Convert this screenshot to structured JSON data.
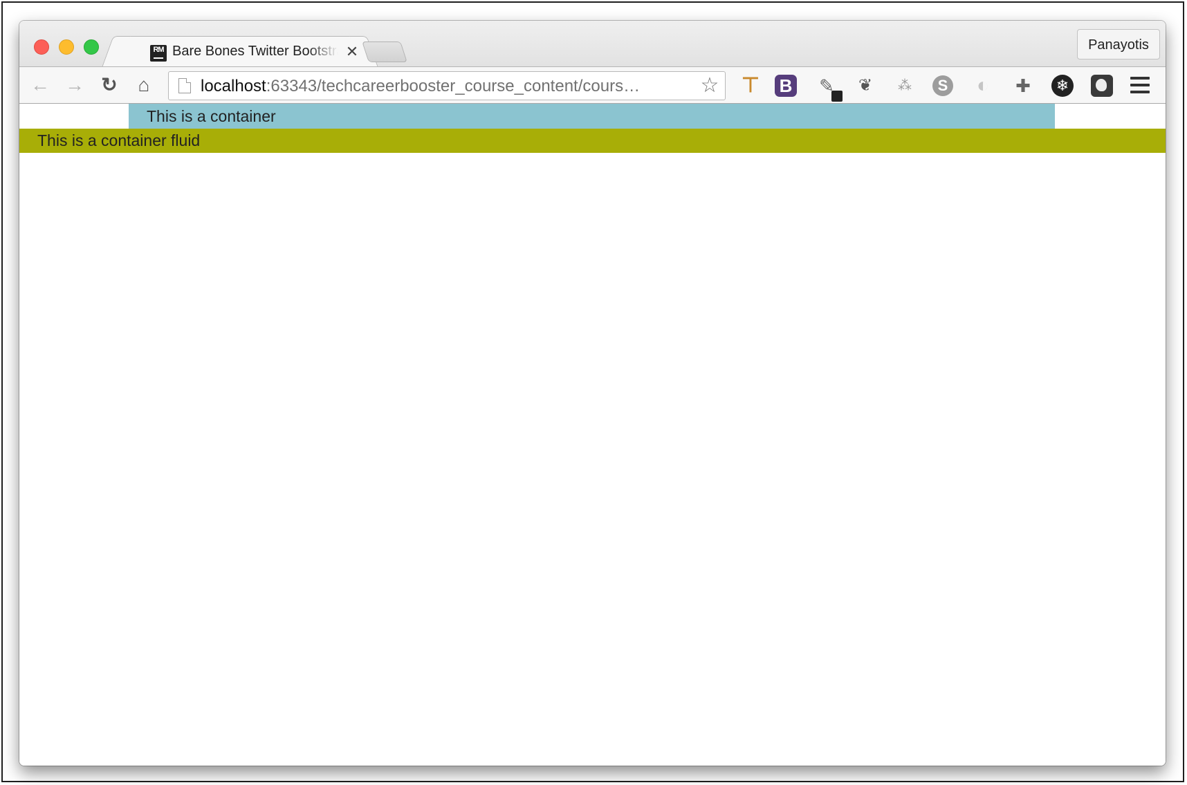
{
  "browser": {
    "tab": {
      "favicon_text": "RM",
      "title": "Bare Bones Twitter Bootstrap",
      "close_glyph": "✕"
    },
    "profile_name": "Panayotis",
    "omnibox": {
      "url_host": "localhost",
      "url_rest": ":63343/techcareerbooster_course_content/cours…"
    },
    "nav_icons": [
      "back-arrow-icon",
      "forward-arrow-icon",
      "reload-icon",
      "home-icon"
    ],
    "extension_icons": [
      "signpost-icon",
      "bootstrap-b-icon",
      "eyedropper-icon",
      "evernote-icon",
      "sitemap-icon",
      "skype-icon",
      "sync-icon",
      "puzzle-extensions-icon",
      "snowflake-icon",
      "ghostery-icon",
      "hamburger-menu-icon"
    ],
    "ext_b_label": "B",
    "ext_skype_label": "S"
  },
  "page": {
    "container_text": "This is a container",
    "container_fluid_text": "This is a container fluid"
  },
  "colors": {
    "container_bg": "#8bc4d0",
    "container_fluid_bg": "#a8ae07"
  }
}
